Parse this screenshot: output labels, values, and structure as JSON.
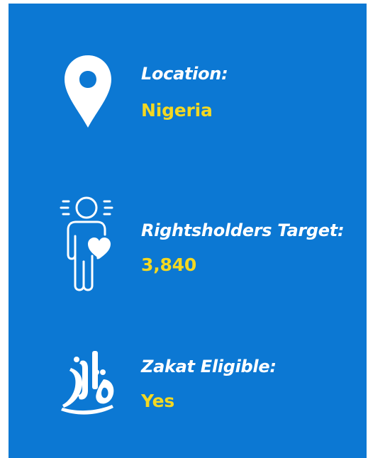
{
  "colors": {
    "panel_background": "#0c78d3",
    "label_text": "#ffffff",
    "value_text": "#f4d821",
    "icon": "#ffffff"
  },
  "items": [
    {
      "icon": "map-pin-icon",
      "label": "Location:",
      "value": "Nigeria"
    },
    {
      "icon": "person-heart-icon",
      "label": "Rightsholders Target:",
      "value": "3,840"
    },
    {
      "icon": "zakat-calligraphy-icon",
      "label": "Zakat Eligible:",
      "value": "Yes"
    }
  ]
}
